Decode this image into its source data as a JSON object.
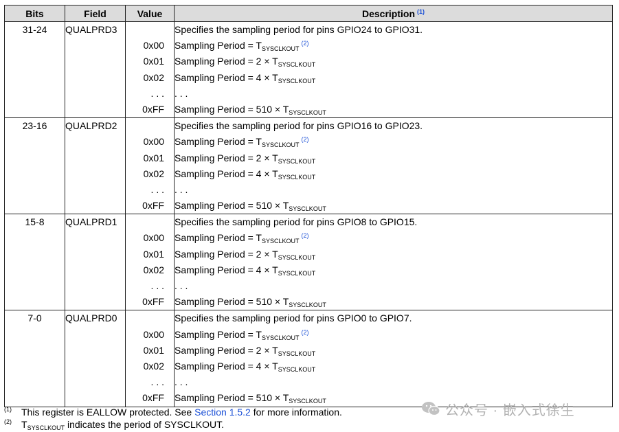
{
  "header": {
    "bits": "Bits",
    "field": "Field",
    "value": "Value",
    "description": "Description",
    "description_ref": "(1)"
  },
  "groups": [
    {
      "bits": "31-24",
      "field": "QUALPRD3",
      "summary": "Specifies the sampling period for pins GPIO24 to GPIO31.",
      "rows": [
        {
          "value": "0x00",
          "text": "Sampling Period = T",
          "sub": "SYSCLKOUT",
          "ref": "(2)"
        },
        {
          "value": "0x01",
          "text": "Sampling Period = 2 × T",
          "sub": "SYSCLKOUT"
        },
        {
          "value": "0x02",
          "text": "Sampling Period = 4 × T",
          "sub": "SYSCLKOUT"
        },
        {
          "value": ". . .",
          "text": ". . ."
        },
        {
          "value": "0xFF",
          "text": "Sampling Period = 510 × T",
          "sub": "SYSCLKOUT"
        }
      ]
    },
    {
      "bits": "23-16",
      "field": "QUALPRD2",
      "summary": "Specifies the sampling period for pins GPIO16 to GPIO23.",
      "rows": [
        {
          "value": "0x00",
          "text": "Sampling Period = T",
          "sub": "SYSCLKOUT",
          "ref": "(2)"
        },
        {
          "value": "0x01",
          "text": "Sampling Period = 2 × T",
          "sub": "SYSCLKOUT"
        },
        {
          "value": "0x02",
          "text": "Sampling Period = 4 × T",
          "sub": "SYSCLKOUT"
        },
        {
          "value": ". . .",
          "text": ". . ."
        },
        {
          "value": "0xFF",
          "text": "Sampling Period = 510 × T",
          "sub": "SYSCLKOUT"
        }
      ]
    },
    {
      "bits": "15-8",
      "field": "QUALPRD1",
      "summary": "Specifies the sampling period for pins GPIO8 to GPIO15.",
      "rows": [
        {
          "value": "0x00",
          "text": "Sampling Period = T",
          "sub": "SYSCLKOUT",
          "ref": "(2)"
        },
        {
          "value": "0x01",
          "text": "Sampling Period = 2 × T",
          "sub": "SYSCLKOUT"
        },
        {
          "value": "0x02",
          "text": "Sampling Period = 4 × T",
          "sub": "SYSCLKOUT"
        },
        {
          "value": ". . .",
          "text": ". . ."
        },
        {
          "value": "0xFF",
          "text": "Sampling Period = 510 × T",
          "sub": "SYSCLKOUT"
        }
      ]
    },
    {
      "bits": "7-0",
      "field": "QUALPRD0",
      "summary": "Specifies the sampling period for pins GPIO0 to GPIO7.",
      "rows": [
        {
          "value": "0x00",
          "text": "Sampling Period = T",
          "sub": "SYSCLKOUT",
          "ref": "(2)"
        },
        {
          "value": "0x01",
          "text": "Sampling Period = 2 × T",
          "sub": "SYSCLKOUT"
        },
        {
          "value": "0x02",
          "text": "Sampling Period = 4 × T",
          "sub": "SYSCLKOUT"
        },
        {
          "value": ". . .",
          "text": ". . ."
        },
        {
          "value": "0xFF",
          "text": "Sampling Period = 510 × T",
          "sub": "SYSCLKOUT"
        }
      ]
    }
  ],
  "footnotes": [
    {
      "mark": "(1)",
      "before": "This register is EALLOW protected. See ",
      "link": "Section 1.5.2",
      "after": " for more information."
    },
    {
      "mark": "(2)",
      "before": "T",
      "sub": "SYSCLKOUT",
      "after": " indicates the period of SYSCLKOUT."
    }
  ],
  "watermark": {
    "text": "公众号 · 嵌入式徐生",
    "icon": "wechat-icon"
  },
  "colors": {
    "header_bg": "#dcdcdc",
    "link": "#1a4fd6",
    "watermark": "#b3b3b3"
  }
}
